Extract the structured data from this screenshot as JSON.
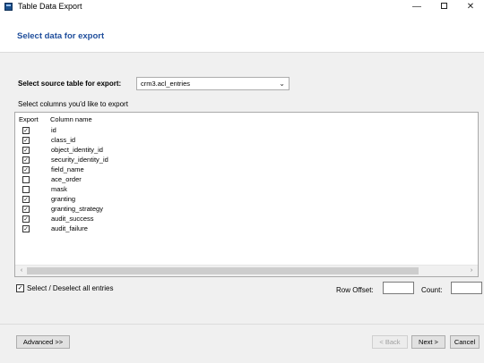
{
  "window": {
    "title": "Table Data Export",
    "minimize_glyph": "—",
    "close_glyph": "✕"
  },
  "header": {
    "title": "Select data for export"
  },
  "source": {
    "label": "Select source table for export:",
    "selected": "crm3.acl_entries",
    "chevron_glyph": "⌄"
  },
  "columns_prompt": "Select columns you'd like to export",
  "list": {
    "col_export": "Export",
    "col_name": "Column name",
    "rows": [
      {
        "name": "id",
        "checked": true
      },
      {
        "name": "class_id",
        "checked": true
      },
      {
        "name": "object_identity_id",
        "checked": true
      },
      {
        "name": "security_identity_id",
        "checked": true
      },
      {
        "name": "field_name",
        "checked": true
      },
      {
        "name": "ace_order",
        "checked": false
      },
      {
        "name": "mask",
        "checked": false
      },
      {
        "name": "granting",
        "checked": true
      },
      {
        "name": "granting_strategy",
        "checked": true
      },
      {
        "name": "audit_success",
        "checked": true
      },
      {
        "name": "audit_failure",
        "checked": true
      }
    ],
    "scroll_left_glyph": "‹",
    "scroll_right_glyph": "›"
  },
  "select_all": {
    "label": "Select / Deselect all entries",
    "checked": true
  },
  "row_offset": {
    "label": "Row Offset:",
    "value": ""
  },
  "count": {
    "label": "Count:",
    "value": ""
  },
  "buttons": {
    "advanced": "Advanced >>",
    "back": "< Back",
    "next": "Next >",
    "cancel": "Cancel"
  },
  "check_glyph": "✓"
}
